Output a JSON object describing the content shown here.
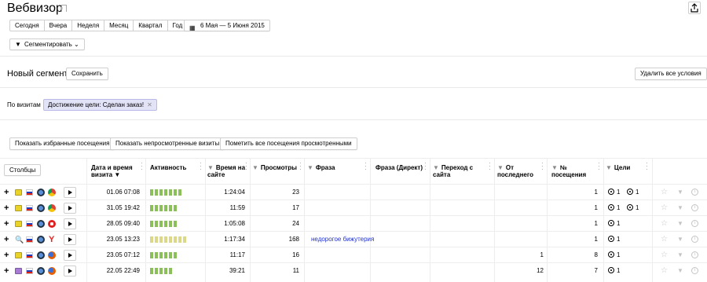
{
  "title": "Вебвизор",
  "periods": [
    "Сегодня",
    "Вчера",
    "Неделя",
    "Месяц",
    "Квартал",
    "Год"
  ],
  "date_range": "6 Мая — 5 Июня 2015",
  "segment_button": "Сегментировать",
  "new_segment": {
    "title": "Новый сегмент",
    "save_label": "Сохранить",
    "remove_all_label": "Удалить все условия"
  },
  "filters": {
    "by_visits_label": "По визитам",
    "chip_label": "Достижение цели: Сделан заказ!"
  },
  "actions": {
    "show_favorites": "Показать избранные посещения",
    "show_unviewed": "Показать непросмотренные визиты",
    "mark_all_viewed": "Пометить все посещения просмотренными"
  },
  "table": {
    "columns_button": "Столбцы",
    "headers": {
      "date": "Дата и время визита",
      "activity": "Активность",
      "time_on_site": "Время на сайте",
      "views": "Просмотры",
      "phrase": "Фраза",
      "phrase_direct": "Фраза (Директ)",
      "referrer": "Переход с сайта",
      "since_last": "От последнего",
      "visit_no": "№ посещения",
      "goals": "Цели"
    },
    "rows": [
      {
        "plus": "+",
        "date": "01.06 07:08",
        "activity_level": 7,
        "activity_color": "#8bbf5a",
        "time": "1:24:04",
        "views": "23",
        "phrase": "",
        "since_last": "",
        "visit_no": "1",
        "goals": [
          "1",
          "1"
        ],
        "source_icon": "#e9d32a",
        "browser": "chrome"
      },
      {
        "plus": "+",
        "date": "31.05 19:42",
        "activity_level": 6,
        "activity_color": "#8bbf5a",
        "time": "11:59",
        "views": "17",
        "phrase": "",
        "since_last": "",
        "visit_no": "1",
        "goals": [
          "1",
          "1"
        ],
        "source_icon": "#e9d32a",
        "browser": "chrome"
      },
      {
        "plus": "+",
        "date": "28.05 09:40",
        "activity_level": 6,
        "activity_color": "#8bbf5a",
        "time": "1:05:08",
        "views": "24",
        "phrase": "",
        "since_last": "",
        "visit_no": "1",
        "goals": [
          "1"
        ],
        "source_icon": "#e9d32a",
        "browser": "opera"
      },
      {
        "plus": "+",
        "date": "23.05 13:23",
        "activity_level": 8,
        "activity_color": "#dcd88a",
        "time": "1:17:34",
        "views": "168",
        "phrase": "недорогое бижутерия",
        "since_last": "",
        "visit_no": "1",
        "goals": [
          "1"
        ],
        "source_icon": "search",
        "browser": "yandex"
      },
      {
        "plus": "+",
        "date": "23.05 07:12",
        "activity_level": 6,
        "activity_color": "#8bbf5a",
        "time": "11:17",
        "views": "16",
        "phrase": "",
        "since_last": "1",
        "visit_no": "8",
        "goals": [
          "1"
        ],
        "source_icon": "#e9d32a",
        "browser": "firefox"
      },
      {
        "plus": "+",
        "date": "22.05 22:49",
        "activity_level": 5,
        "activity_color": "#8bbf5a",
        "time": "39:21",
        "views": "11",
        "phrase": "",
        "since_last": "12",
        "visit_no": "7",
        "goals": [
          "1"
        ],
        "source_icon": "#a77ad4",
        "browser": "firefox"
      }
    ]
  }
}
